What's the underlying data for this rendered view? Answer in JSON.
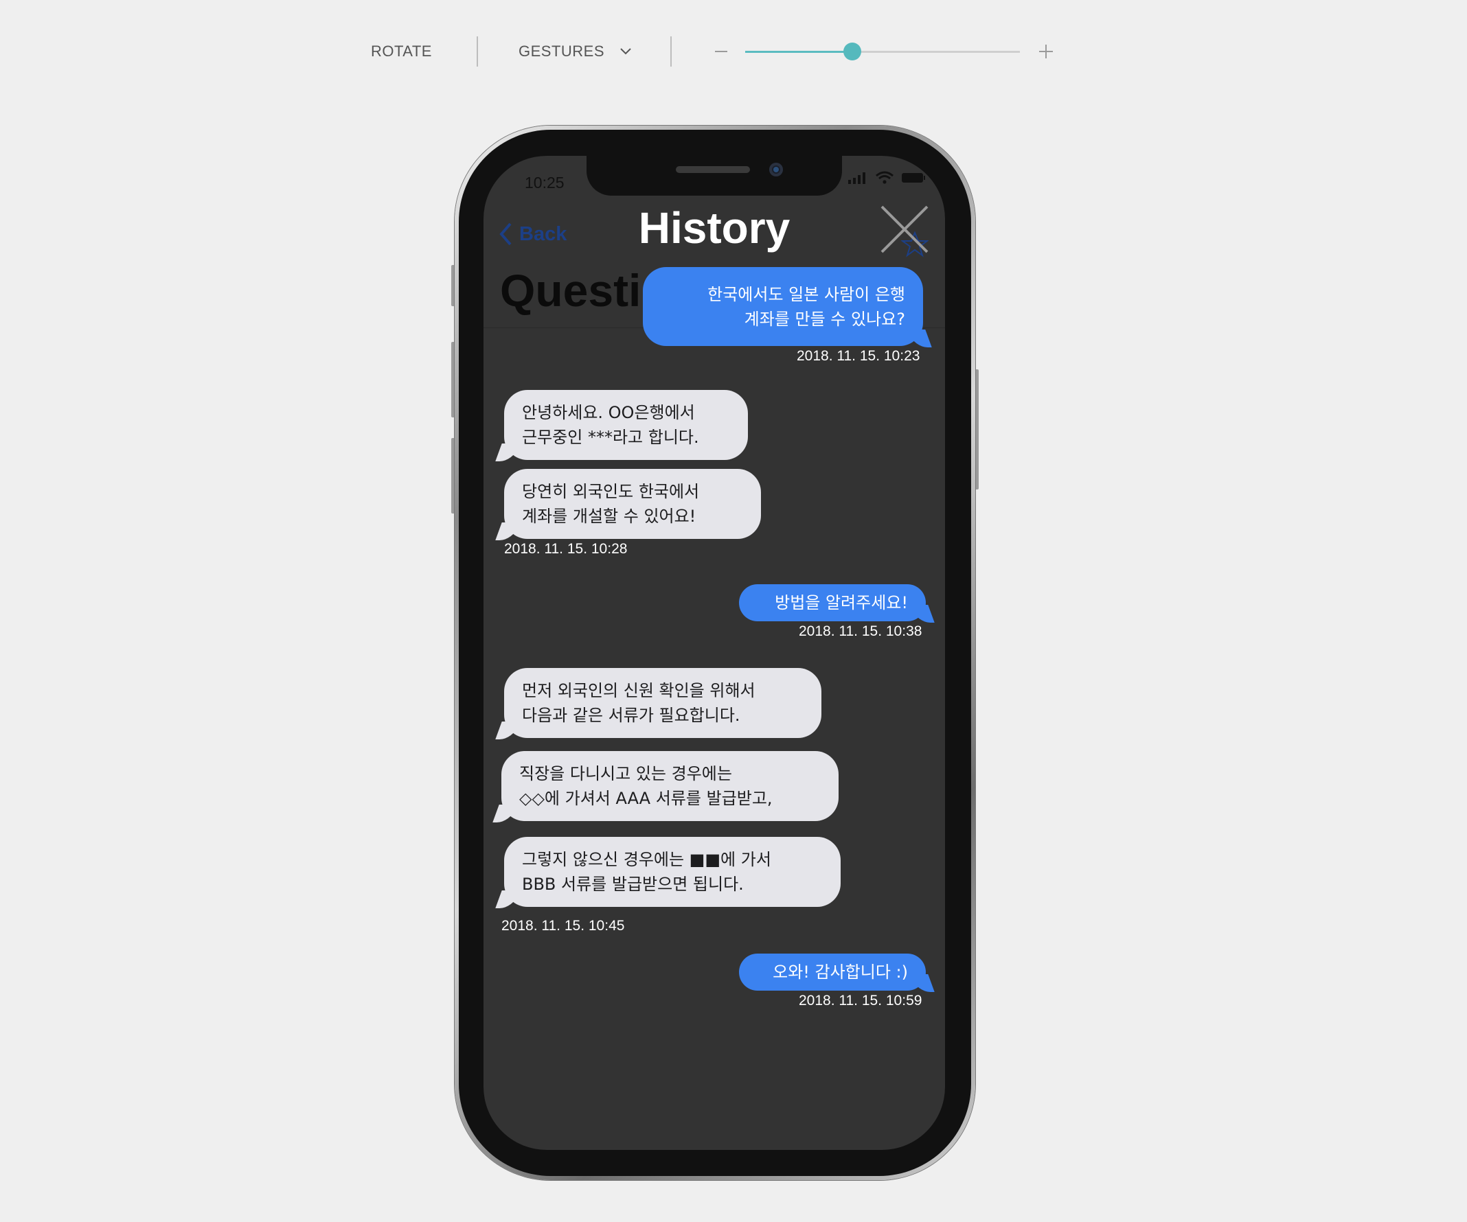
{
  "toolbar": {
    "rotate_label": "ROTATE",
    "gestures_label": "GESTURES",
    "zoom_value_fraction": 0.39,
    "accent_color": "#55b9bd"
  },
  "status_bar": {
    "time": "10:25"
  },
  "nav": {
    "back_label": "Back",
    "title": "History",
    "behind_heading": "Questic"
  },
  "messages": [
    {
      "dir": "out",
      "lines": [
        "한국에서도 일본 사람이 은행",
        "계좌를 만들 수 있나요?"
      ]
    },
    {
      "dir": "in",
      "lines": [
        "안녕하세요. OO은행에서",
        "근무중인 ***라고 합니다."
      ]
    },
    {
      "dir": "in",
      "lines": [
        "당연히 외국인도 한국에서",
        "계좌를 개설할 수 있어요!"
      ]
    },
    {
      "dir": "out",
      "lines": [
        "방법을 알려주세요!"
      ]
    },
    {
      "dir": "in",
      "lines": [
        "먼저 외국인의 신원 확인을 위해서",
        "다음과 같은 서류가 필요합니다."
      ]
    },
    {
      "dir": "in",
      "lines": [
        "직장을 다니시고 있는 경우에는",
        "◇◇에 가셔서 AAA 서류를 발급받고,"
      ]
    },
    {
      "dir": "in",
      "lines": [
        "그렇지 않으신 경우에는 ■■에 가서",
        "BBB 서류를 발급받으면 됩니다."
      ]
    },
    {
      "dir": "out",
      "lines": [
        "오와! 감사합니다 :)"
      ]
    }
  ],
  "timestamps": [
    "2018. 11. 15.  10:23",
    "2018. 11. 15.  10:28",
    "2018. 11. 15.  10:38",
    "2018. 11. 15.  10:45",
    "2018. 11. 15.  10:59"
  ],
  "colors": {
    "outgoing_bubble": "#3b82f0",
    "incoming_bubble": "#e5e5ea",
    "screen_background": "#333333"
  },
  "icons": [
    "chevron-down-icon",
    "minus-icon",
    "plus-icon",
    "signal-icon",
    "wifi-icon",
    "battery-icon",
    "back-chevron-icon",
    "close-icon",
    "star-icon"
  ]
}
